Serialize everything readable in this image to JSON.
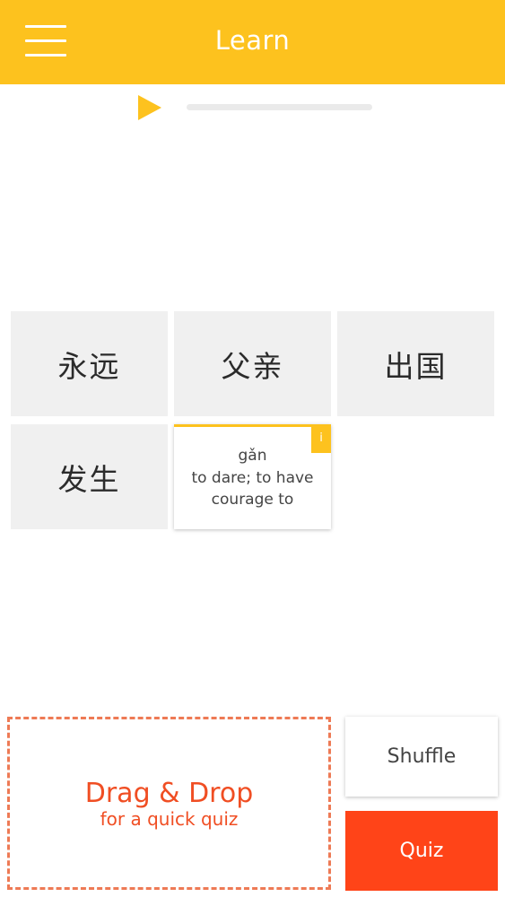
{
  "header": {
    "title": "Learn",
    "menu_icon": "hamburger-menu-icon",
    "background_color": "#FDC21E"
  },
  "audio": {
    "play_icon": "play-icon",
    "progress_percent": 0
  },
  "tiles": [
    {
      "text": "永远"
    },
    {
      "text": "父亲"
    },
    {
      "text": "出国"
    },
    {
      "text": "发生"
    }
  ],
  "info_card": {
    "badge": "i",
    "pinyin": "gǎn",
    "meaning": "to dare; to have courage to"
  },
  "dropzone": {
    "title": "Drag & Drop",
    "subtitle": "for a quick quiz",
    "accent_color": "#F04E23"
  },
  "buttons": {
    "shuffle_label": "Shuffle",
    "quiz_label": "Quiz",
    "quiz_color": "#FF4418"
  }
}
